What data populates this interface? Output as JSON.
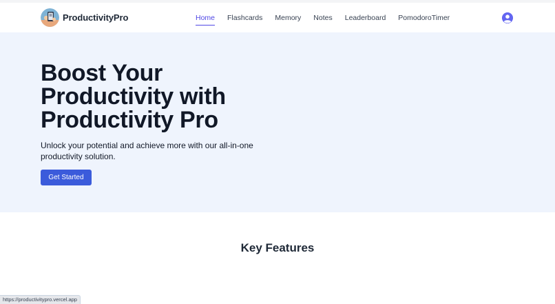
{
  "brand": {
    "name": "ProductivityPro"
  },
  "nav": {
    "items": [
      {
        "label": "Home",
        "active": true
      },
      {
        "label": "Flashcards",
        "active": false
      },
      {
        "label": "Memory",
        "active": false
      },
      {
        "label": "Notes",
        "active": false
      },
      {
        "label": "Leaderboard",
        "active": false
      },
      {
        "label": "PomodoroTimer",
        "active": false
      }
    ]
  },
  "hero": {
    "title": "Boost Your Productivity with Productivity Pro",
    "subtitle": "Unlock your potential and achieve more with our all-in-one productivity solution.",
    "cta_label": "Get Started"
  },
  "features": {
    "title": "Key Features"
  },
  "status_bar": {
    "url": "https://productivitypro.vercel.app"
  },
  "colors": {
    "accent": "#4f46e5",
    "cta": "#3b5bdb",
    "hero_bg": "#eff4fd"
  }
}
